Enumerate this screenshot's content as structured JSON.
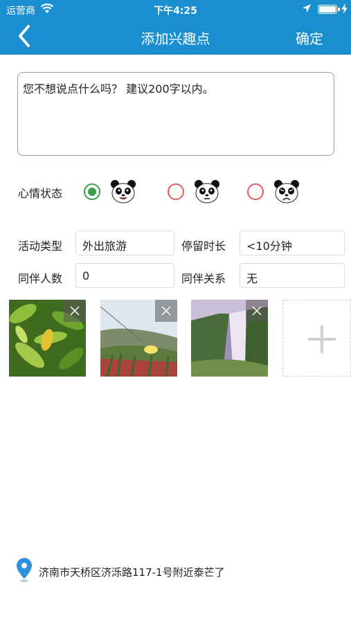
{
  "status_bar": {
    "carrier": "运营商",
    "time": "下午4:25"
  },
  "nav": {
    "title": "添加兴趣点",
    "confirm_label": "确定",
    "back_icon": "chevron-left-icon"
  },
  "note": {
    "placeholder": "您不想说点什么吗？ 建议200字以内。",
    "value": ""
  },
  "mood": {
    "label": "心情状态",
    "options": [
      {
        "icon": "panda-happy-icon",
        "selected": true
      },
      {
        "icon": "panda-neutral-icon",
        "selected": false
      },
      {
        "icon": "panda-sad-icon",
        "selected": false
      }
    ]
  },
  "fields": {
    "activity_type": {
      "label": "活动类型",
      "value": "外出旅游"
    },
    "stay_duration": {
      "label": "停留时长",
      "value": "<10分钟"
    },
    "companion_count": {
      "label": "同伴人数",
      "value": "0"
    },
    "companion_relation": {
      "label": "同伴关系",
      "value": "无"
    }
  },
  "photos": [
    {
      "subject": "yellow fruit on green leaves"
    },
    {
      "subject": "flowers on hillside"
    },
    {
      "subject": "waterfall"
    }
  ],
  "location": {
    "text": "济南市天桥区济泺路117-1号附近泰芒了",
    "icon": "map-pin-icon"
  },
  "colors": {
    "accent": "#1a8fd0",
    "selected_radio": "#3aa04a",
    "unselected_radio": "#e25c5c"
  }
}
